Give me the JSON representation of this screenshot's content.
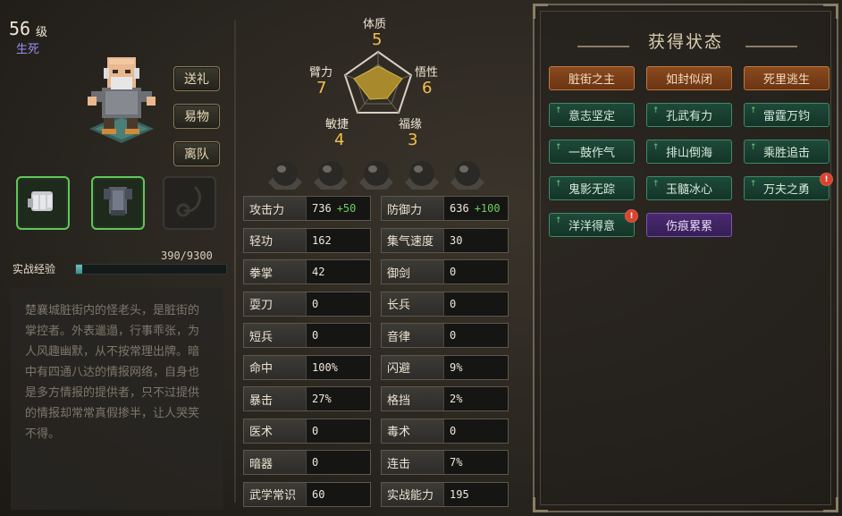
{
  "character": {
    "level": "56",
    "level_unit": "级",
    "realm": "生死",
    "description": "楚襄城脏街内的怪老头，是脏街的掌控者。外表邋遢，行事乖张，为人风趣幽默，从不按常理出牌。暗中有四通八达的情报网络，自身也是多方情报的提供者，只不过提供的情报却常常真假掺半，让人哭笑不得。"
  },
  "actions": {
    "gift": "送礼",
    "trade": "易物",
    "leave": "离队"
  },
  "equipment": [
    {
      "slot": "gloves",
      "equipped": true,
      "icon": "gauntlet-icon"
    },
    {
      "slot": "armor",
      "equipped": true,
      "icon": "armor-icon"
    },
    {
      "slot": "accessory",
      "equipped": false,
      "icon": "pendant-icon"
    }
  ],
  "experience": {
    "label": "实战经验",
    "text": "390/9300",
    "current": 390,
    "max": 9300
  },
  "attributes": {
    "constitution": {
      "name": "体质",
      "value": "5"
    },
    "strength": {
      "name": "臂力",
      "value": "7"
    },
    "insight": {
      "name": "悟性",
      "value": "6"
    },
    "agility": {
      "name": "敏捷",
      "value": "4"
    },
    "fortune": {
      "name": "福缘",
      "value": "3"
    }
  },
  "stats": [
    {
      "label": "攻击力",
      "value": "736",
      "bonus": "+50"
    },
    {
      "label": "防御力",
      "value": "636",
      "bonus": "+100"
    },
    {
      "label": "轻功",
      "value": "162"
    },
    {
      "label": "集气速度",
      "value": "30"
    },
    {
      "label": "拳掌",
      "value": "42"
    },
    {
      "label": "御剑",
      "value": "0"
    },
    {
      "label": "耍刀",
      "value": "0"
    },
    {
      "label": "长兵",
      "value": "0"
    },
    {
      "label": "短兵",
      "value": "0"
    },
    {
      "label": "音律",
      "value": "0"
    },
    {
      "label": "命中",
      "value": "100%"
    },
    {
      "label": "闪避",
      "value": "9%"
    },
    {
      "label": "暴击",
      "value": "27%"
    },
    {
      "label": "格挡",
      "value": "2%"
    },
    {
      "label": "医术",
      "value": "0"
    },
    {
      "label": "毒术",
      "value": "0"
    },
    {
      "label": "暗器",
      "value": "0"
    },
    {
      "label": "连击",
      "value": "7%"
    },
    {
      "label": "武学常识",
      "value": "60"
    },
    {
      "label": "实战能力",
      "value": "195"
    }
  ],
  "status": {
    "title": "获得状态",
    "buffs": [
      {
        "name": "脏街之主",
        "type": "orange"
      },
      {
        "name": "如封似闭",
        "type": "orange"
      },
      {
        "name": "死里逃生",
        "type": "orange"
      },
      {
        "name": "意志坚定",
        "type": "green",
        "up": true
      },
      {
        "name": "孔武有力",
        "type": "green",
        "up": true
      },
      {
        "name": "雷霆万钧",
        "type": "green",
        "up": true
      },
      {
        "name": "一鼓作气",
        "type": "green",
        "up": true
      },
      {
        "name": "排山倒海",
        "type": "green",
        "up": true
      },
      {
        "name": "乘胜追击",
        "type": "green",
        "up": true
      },
      {
        "name": "鬼影无踪",
        "type": "green",
        "up": true
      },
      {
        "name": "玉髓冰心",
        "type": "green",
        "up": true
      },
      {
        "name": "万夫之勇",
        "type": "green",
        "up": true,
        "warn": true
      },
      {
        "name": "洋洋得意",
        "type": "green",
        "up": true,
        "warn": true
      },
      {
        "name": "伤痕累累",
        "type": "purple"
      }
    ]
  },
  "colors": {
    "accent": "#f2c04a",
    "bonus": "#6ccf5e",
    "realm": "#9a8ef0"
  }
}
